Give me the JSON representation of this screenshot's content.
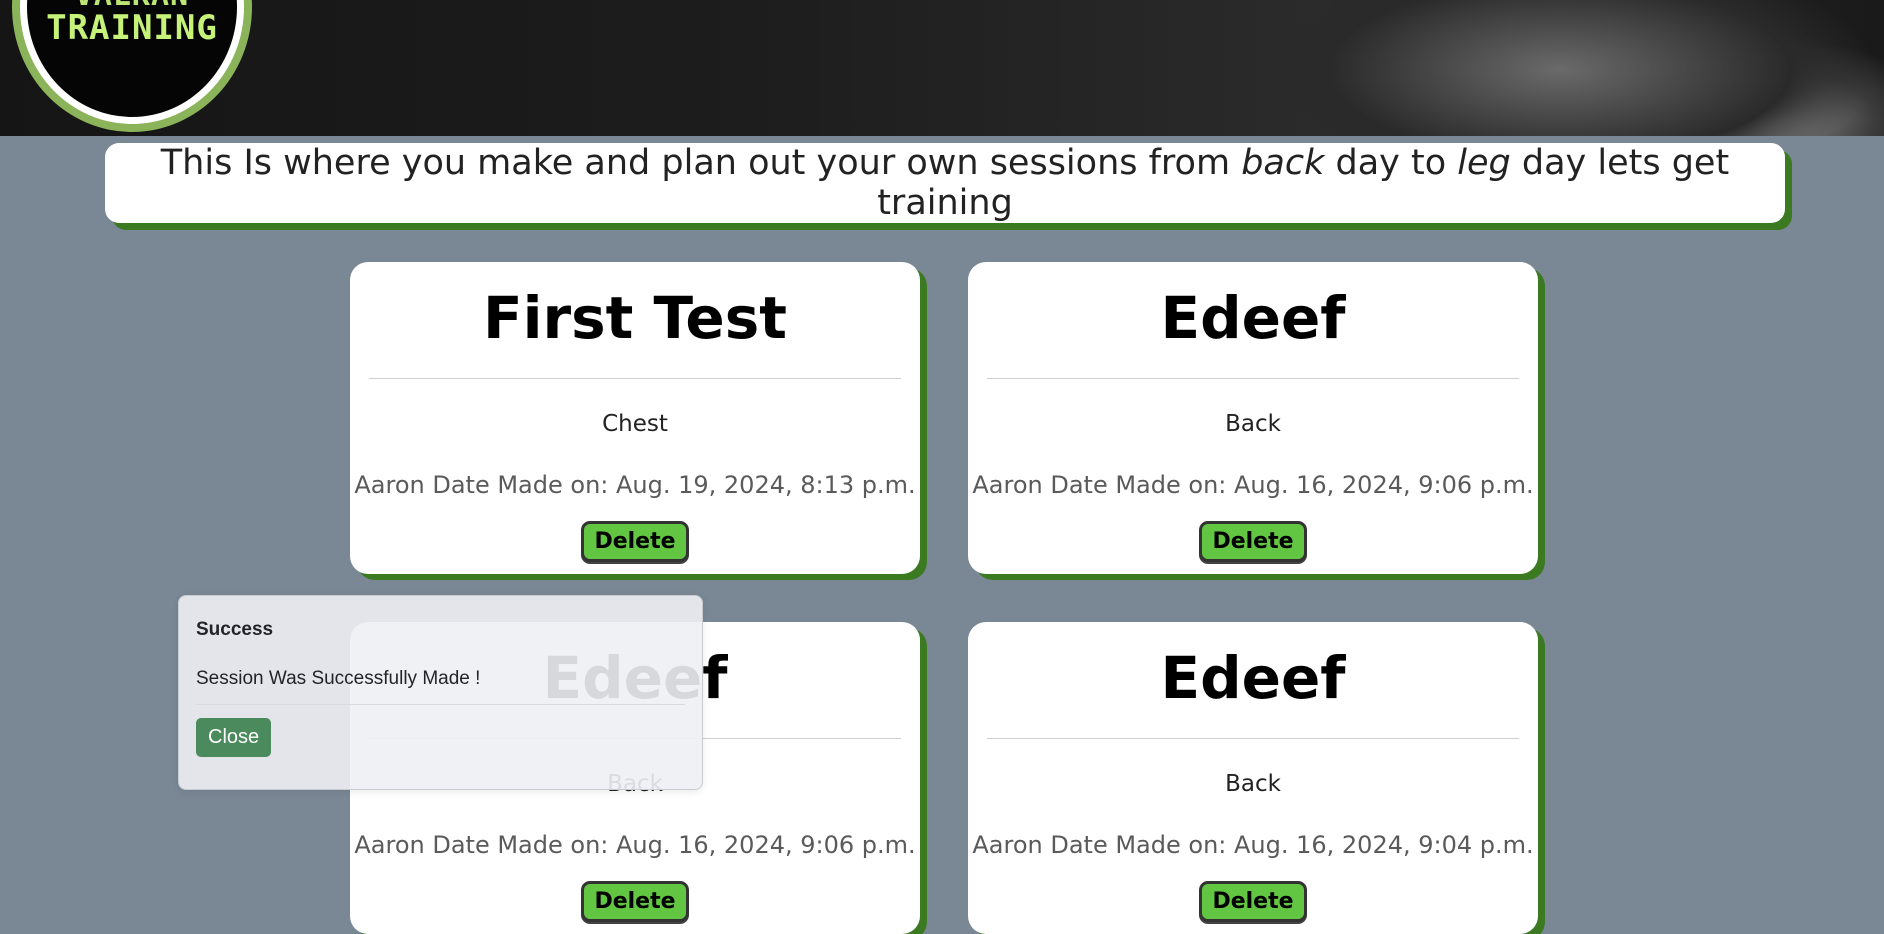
{
  "header": {
    "logo_line1": "VALKAN",
    "logo_line2": "TRAINING"
  },
  "intro": {
    "text_before": "This Is where you make and plan out your own sessions from ",
    "em1": "back",
    "text_mid": " day to ",
    "em2": "leg",
    "text_after": " day lets get training"
  },
  "sessions": [
    {
      "title": "First Test",
      "category": "Chest",
      "meta": "Aaron Date Made on: Aug. 19, 2024, 8:13 p.m.",
      "delete_label": "Delete"
    },
    {
      "title": "Edeef",
      "category": "Back",
      "meta": "Aaron Date Made on: Aug. 16, 2024, 9:06 p.m.",
      "delete_label": "Delete"
    },
    {
      "title": "Edeef",
      "category": "Back",
      "meta": "Aaron Date Made on: Aug. 16, 2024, 9:06 p.m.",
      "delete_label": "Delete"
    },
    {
      "title": "Edeef",
      "category": "Back",
      "meta": "Aaron Date Made on: Aug. 16, 2024, 9:04 p.m.",
      "delete_label": "Delete"
    }
  ],
  "toast": {
    "title": "Success",
    "message": "Session Was Successfully Made !",
    "close_label": "Close"
  },
  "colors": {
    "page_bg": "#7a8795",
    "accent_shadow": "#3c7a22",
    "delete_button": "#62c642",
    "close_button": "#4a8a5c"
  }
}
